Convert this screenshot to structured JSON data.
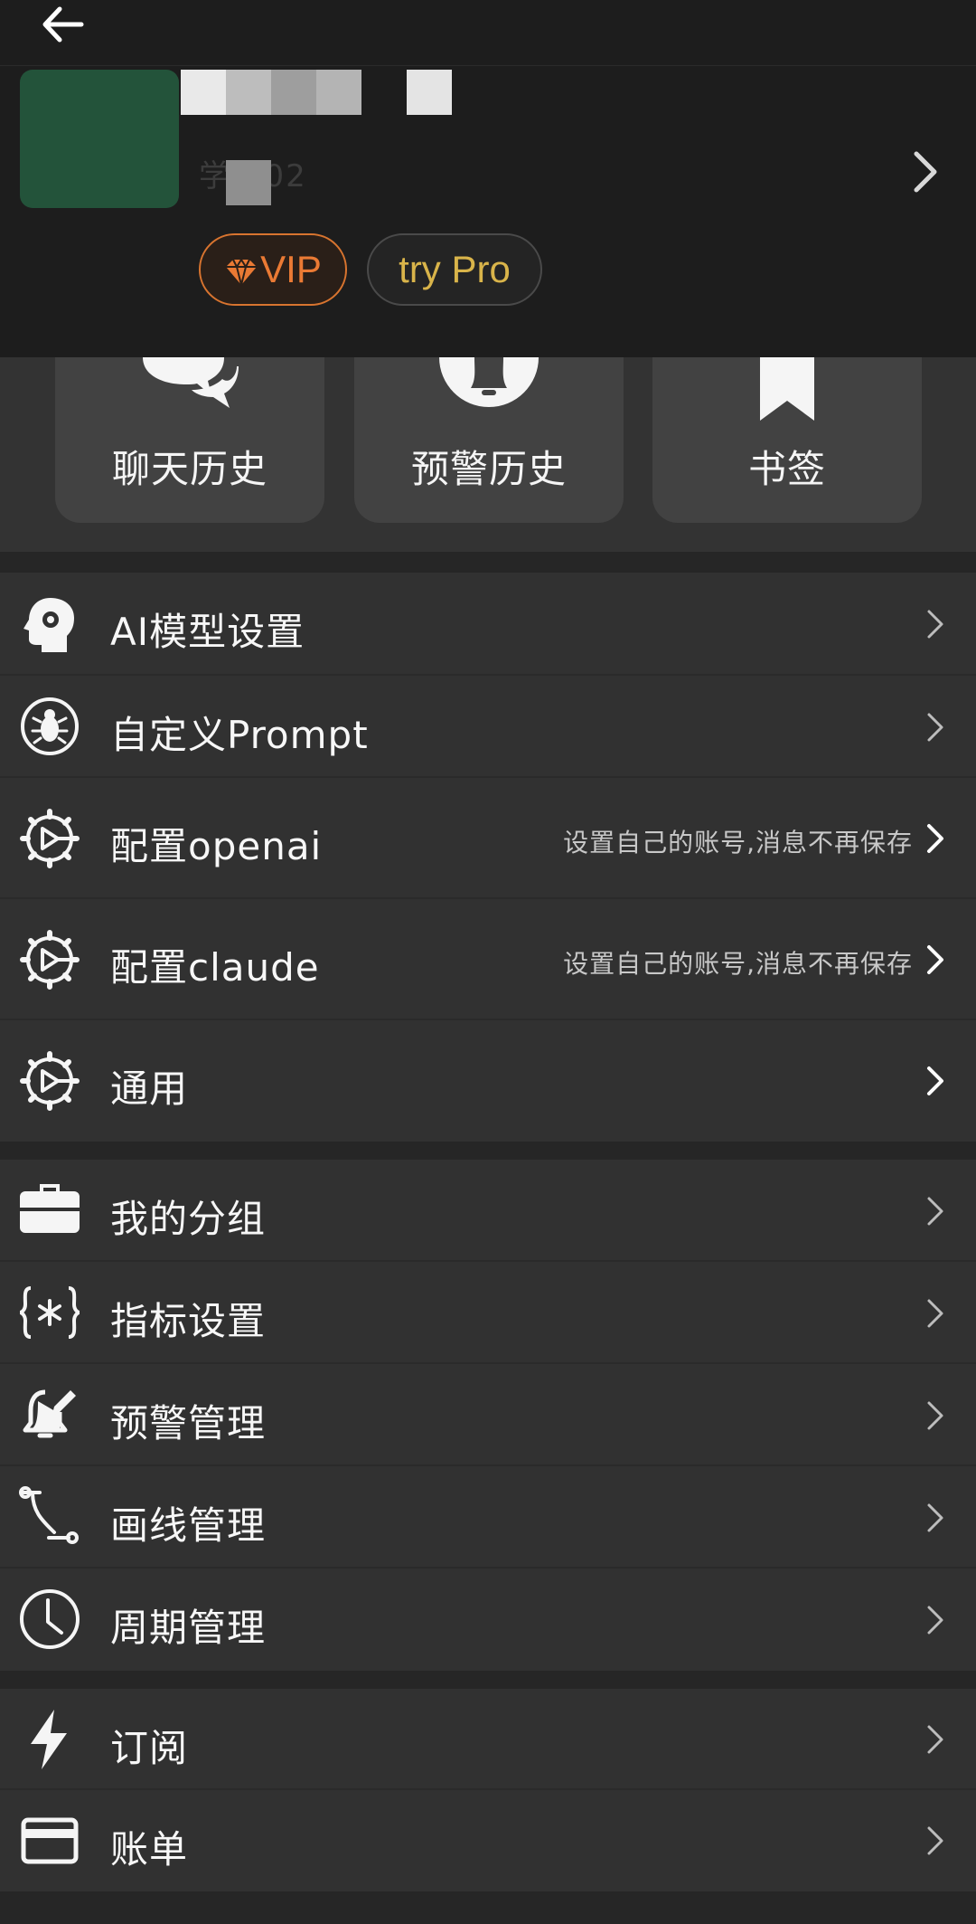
{
  "header": {
    "vip_label": "VIP",
    "pro_label": "try Pro",
    "sub_text": "学 202"
  },
  "shortcuts": [
    {
      "label": "聊天历史",
      "icon": "chat-bubbles-icon"
    },
    {
      "label": "预警历史",
      "icon": "bell-icon"
    },
    {
      "label": "书签",
      "icon": "bookmark-icon"
    }
  ],
  "settings": [
    {
      "label": "AI模型设置",
      "icon": "ai-head-gear-icon",
      "hint": ""
    },
    {
      "label": "自定义Prompt",
      "icon": "bug-icon",
      "hint": ""
    },
    {
      "label": "配置openai",
      "icon": "gear-icon",
      "hint": "设置自己的账号,消息不再保存"
    },
    {
      "label": "配置claude",
      "icon": "gear-icon",
      "hint": "设置自己的账号,消息不再保存"
    },
    {
      "label": "通用",
      "icon": "gear-icon",
      "hint": ""
    }
  ],
  "manage": [
    {
      "label": "我的分组",
      "icon": "briefcase-icon"
    },
    {
      "label": "指标设置",
      "icon": "braces-asterisk-icon"
    },
    {
      "label": "预警管理",
      "icon": "bell-edit-icon"
    },
    {
      "label": "画线管理",
      "icon": "line-draw-icon"
    },
    {
      "label": "周期管理",
      "icon": "clock-icon"
    }
  ],
  "billing": [
    {
      "label": "订阅",
      "icon": "lightning-icon"
    },
    {
      "label": "账单",
      "icon": "credit-card-icon"
    }
  ],
  "colors": {
    "vip": "#ea7a34",
    "pro": "#d9b44a",
    "avatar": "#23533a"
  }
}
